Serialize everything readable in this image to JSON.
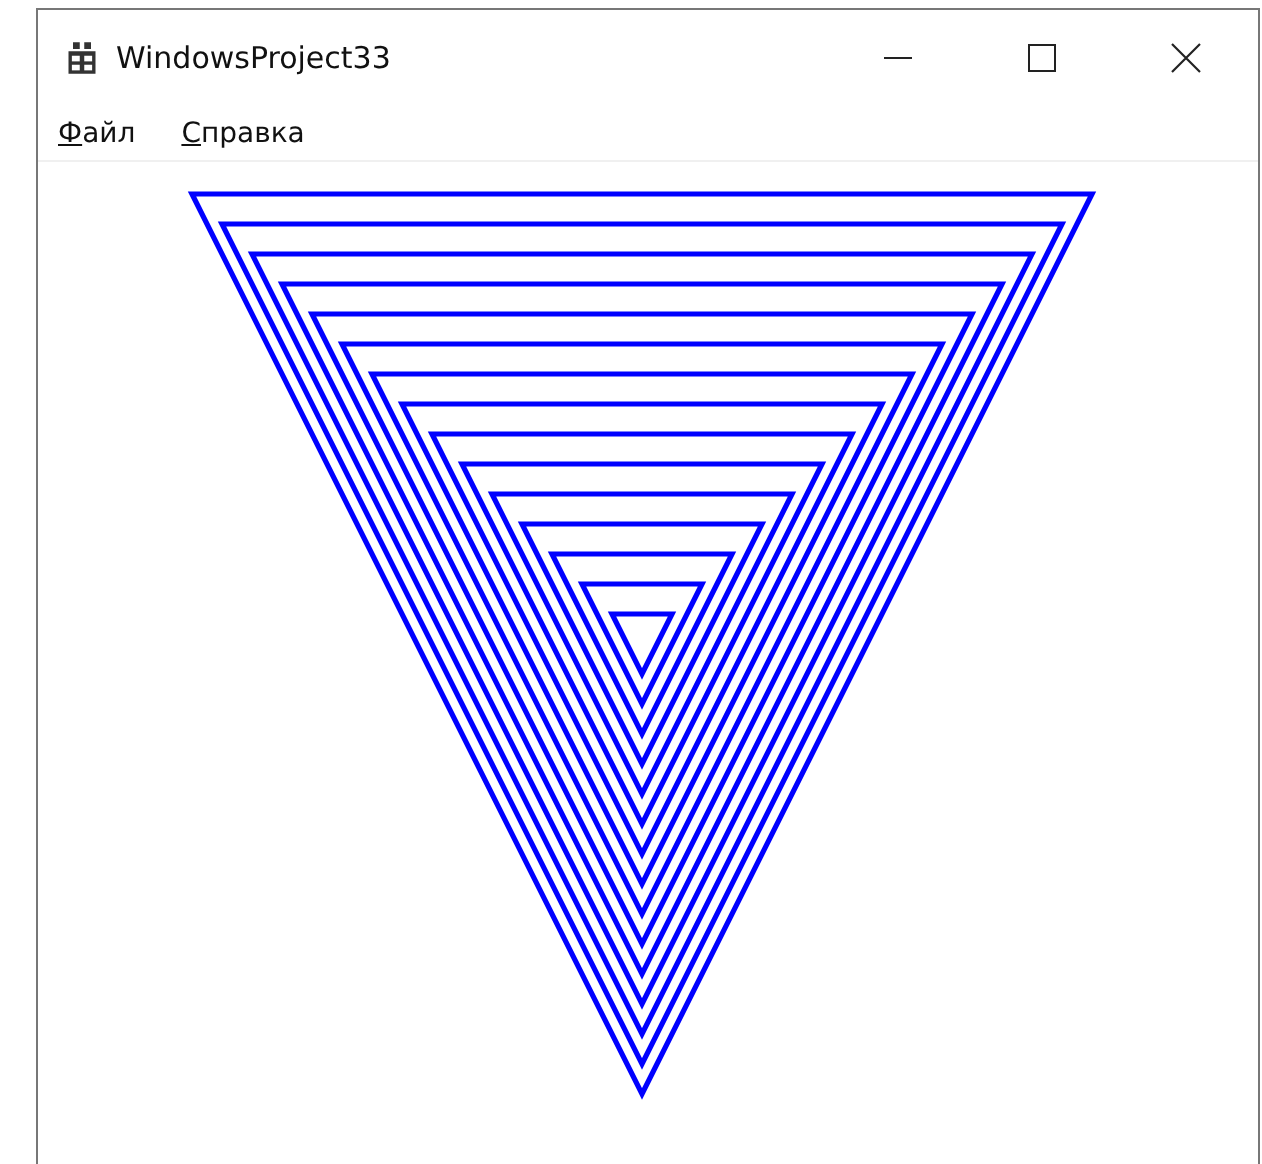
{
  "window": {
    "title": "WindowsProject33"
  },
  "menu": [
    {
      "label": "Файл"
    },
    {
      "label": "Справка"
    }
  ]
}
